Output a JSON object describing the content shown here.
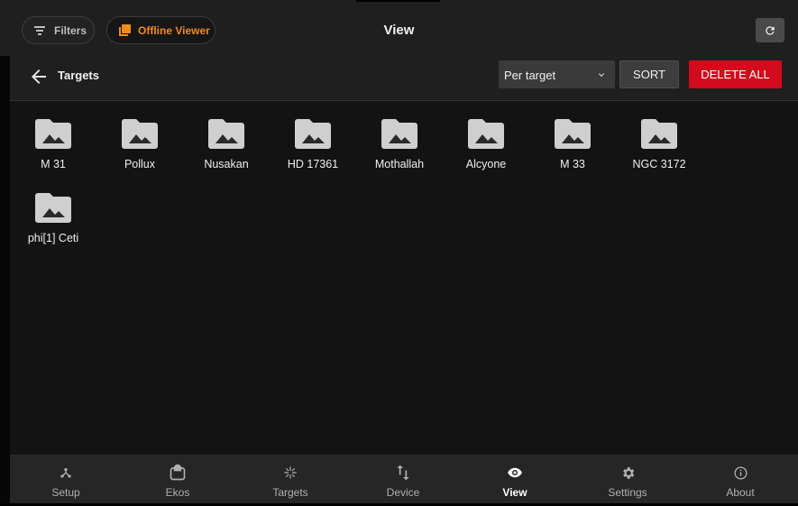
{
  "topbar": {
    "filters_label": "Filters",
    "offline_label": "Offline Viewer",
    "title": "View",
    "accent_color": "#f08a1c"
  },
  "subbar": {
    "breadcrumb": "Targets",
    "select_value": "Per target",
    "sort_label": "SORT",
    "delete_label": "DELETE ALL",
    "delete_color": "#d10a1d"
  },
  "folders": [
    {
      "label": "M 31"
    },
    {
      "label": "Pollux"
    },
    {
      "label": "Nusakan"
    },
    {
      "label": "HD 17361"
    },
    {
      "label": "Mothallah"
    },
    {
      "label": "Alcyone"
    },
    {
      "label": "M 33"
    },
    {
      "label": "NGC 3172"
    },
    {
      "label": "phi[1] Ceti"
    }
  ],
  "nav": [
    {
      "label": "Setup",
      "icon": "setup-icon"
    },
    {
      "label": "Ekos",
      "icon": "ekos-icon"
    },
    {
      "label": "Targets",
      "icon": "targets-icon"
    },
    {
      "label": "Device",
      "icon": "device-icon"
    },
    {
      "label": "View",
      "icon": "eye-icon",
      "active": true
    },
    {
      "label": "Settings",
      "icon": "gear-icon"
    },
    {
      "label": "About",
      "icon": "info-icon"
    }
  ]
}
